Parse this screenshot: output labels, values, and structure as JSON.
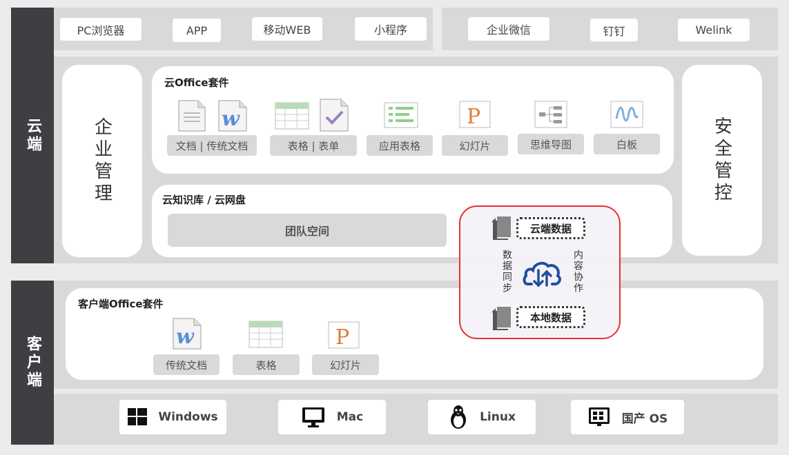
{
  "cloud_label": "云端",
  "client_label": "客户端",
  "access_left": [
    "PC浏览器",
    "APP",
    "移动WEB",
    "小程序"
  ],
  "access_right": [
    "企业微信",
    "钉钉",
    "Welink"
  ],
  "enterprise_mgmt": "企业管理",
  "security_ctrl": "安全管控",
  "cloud_office": {
    "title": "云Office套件",
    "apps": [
      "文档 | 传统文档",
      "表格 | 表单",
      "应用表格",
      "幻灯片",
      "思维导图",
      "白板"
    ]
  },
  "knowledge": {
    "title": "云知识库 / 云网盘",
    "team_space": "团队空间"
  },
  "sync": {
    "cloud_data": "云端数据",
    "local_data": "本地数据",
    "left_text": "数据同步",
    "right_text": "内容协作"
  },
  "client_office": {
    "title": "客户端Office套件",
    "apps": [
      "传统文档",
      "表格",
      "幻灯片"
    ]
  },
  "os": [
    "Windows",
    "Mac",
    "Linux",
    "国产 OS"
  ],
  "colors": {
    "accent_red": "#e43030",
    "dark_bar": "#3d3f42",
    "cloud_blue": "#1e4fa0"
  }
}
